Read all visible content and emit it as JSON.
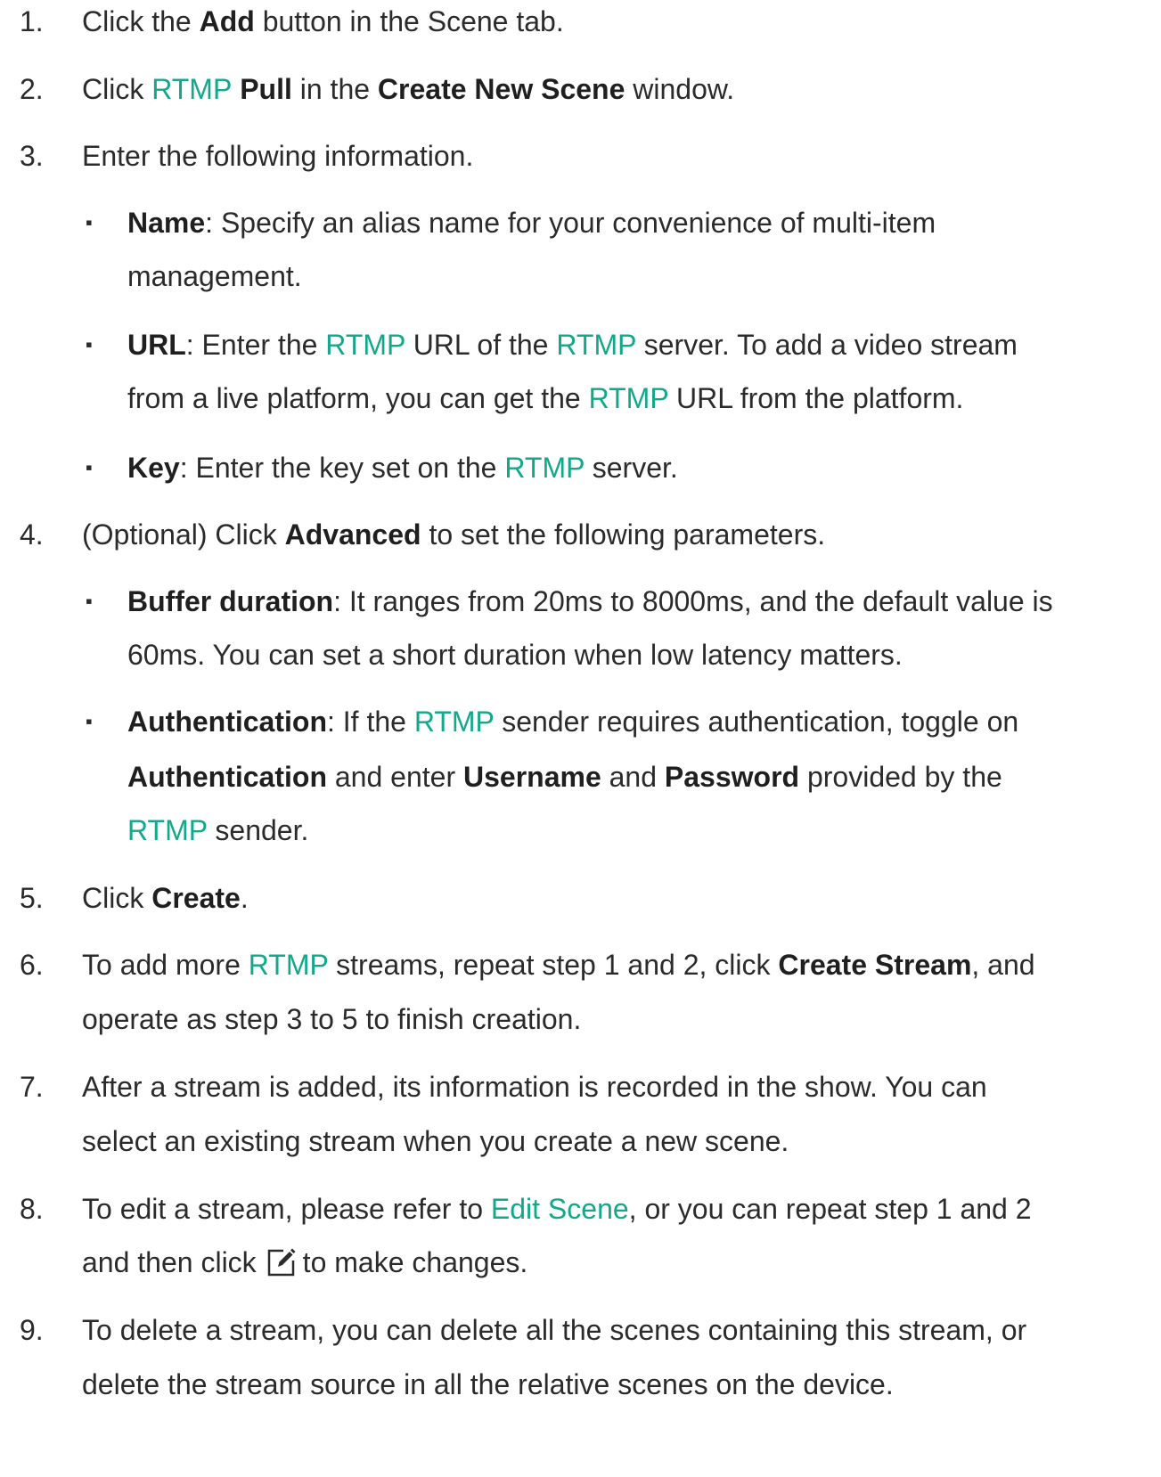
{
  "steps": [
    {
      "num": "1.",
      "a": "Click the ",
      "b": "Add",
      "c": " button in the Scene tab."
    },
    {
      "num": "2.",
      "a": "Click ",
      "link": "RTMP",
      "b1": " Pull",
      "c": " in the ",
      "b2": "Create New Scene",
      "d": " window."
    },
    {
      "num": "3.",
      "a": "Enter the following information.",
      "bullets": [
        {
          "b": "Name",
          "a": ": Specify an alias name for your convenience of multi-item",
          "line2": "management."
        },
        {
          "b": "URL",
          "a": ": Enter the ",
          "l1": "RTMP",
          "m": " URL of the ",
          "l2": "RTMP",
          "n": " server. To add a video stream",
          "line2a": "from a live platform, you can get the ",
          "l3": "RTMP",
          "line2b": " URL from the platform."
        },
        {
          "b": "Key",
          "a": ": Enter the key set on the ",
          "l1": "RTMP",
          "c": " server."
        }
      ]
    },
    {
      "num": "4.",
      "a": "(Optional) Click ",
      "b": "Advanced",
      "c": " to set the following parameters.",
      "bullets": [
        {
          "b": "Buffer duration",
          "a": ": It ranges from 20ms to 8000ms, and the default value is",
          "line2": "60ms. You can set a short duration when low latency matters."
        },
        {
          "b": "Authentication",
          "a": ": If the ",
          "l1": "RTMP",
          "c": " sender requires authentication, toggle on",
          "line2b1": "Authentication",
          "line2a": " and enter ",
          "line2b2": "Username",
          "line2c": " and ",
          "line2b3": "Password",
          "line2d": " provided by the",
          "line3l": "RTMP",
          "line3a": " sender."
        }
      ]
    },
    {
      "num": "5.",
      "a": "Click ",
      "b": "Create",
      "c": "."
    },
    {
      "num": "6.",
      "a": "To add more ",
      "l1": "RTMP",
      "c": " streams, repeat step 1 and 2, click ",
      "b": "Create Stream",
      "d": ", and",
      "line2": "operate as step 3 to 5 to finish creation."
    },
    {
      "num": "7.",
      "a": "After a stream is added, its information is recorded in the show. You can",
      "line2": "select an existing stream when you create a new scene."
    },
    {
      "num": "8.",
      "a": "To edit a stream, please refer to ",
      "l1": "Edit Scene",
      "c": ", or you can repeat step 1 and 2",
      "line2a": "and then click",
      "line2b": "to make changes.",
      "icon": "edit-icon"
    },
    {
      "num": "9.",
      "a": "To delete a stream, you can delete all the scenes containing this stream, or",
      "line2": "delete the stream source in all the relative scenes on the device."
    }
  ],
  "bullet_glyph": "▪",
  "colors": {
    "link": "#13a88a",
    "text": "#2b2b2b"
  }
}
